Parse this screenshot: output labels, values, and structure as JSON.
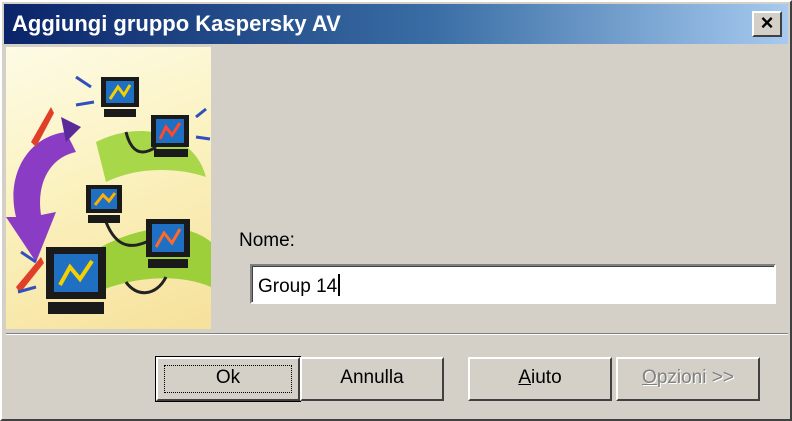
{
  "window": {
    "title": "Aggiungi gruppo Kaspersky AV",
    "close_label": "×"
  },
  "form": {
    "name_label": "Nome:",
    "name_value": "Group 14"
  },
  "buttons": {
    "ok": "Ok",
    "cancel": "Annulla",
    "help_mnemonic": "A",
    "help_rest": "iuto",
    "options_mnemonic": "O",
    "options_rest": "pzioni >>"
  },
  "colors": {
    "titlebar_start": "#0a246a",
    "titlebar_end": "#a6caf0",
    "face": "#d4d0c8"
  },
  "icons": [
    "close-icon",
    "network-computers-illustration"
  ]
}
